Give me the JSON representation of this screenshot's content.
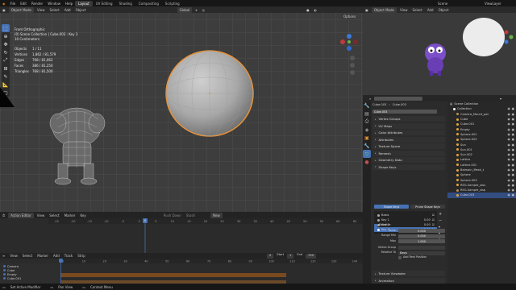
{
  "topbar": {
    "menus": [
      "File",
      "Edit",
      "Render",
      "Window",
      "Help"
    ],
    "workspaces": [
      "Layout",
      "UV Editing",
      "Shading",
      "Compositing",
      "Scripting"
    ],
    "active_workspace": "Layout",
    "scene_label": "Scene",
    "view_layer_label": "ViewLayer"
  },
  "viewport": {
    "mode": "Object Mode",
    "menus": [
      "View",
      "Select",
      "Add",
      "Object"
    ],
    "orientation": "Global",
    "options_label": "Options",
    "info": {
      "view_name": "Front Orthographic",
      "collection_line": "(0) Scene Collection | Cube.003 : Key 3",
      "units": "10 Centimeters"
    },
    "stats": [
      {
        "label": "Objects",
        "value": "1 / 11"
      },
      {
        "label": "Vertices",
        "value": "1,862 / 81,579"
      },
      {
        "label": "Edges",
        "value": "768 / 81,062"
      },
      {
        "label": "Faces",
        "value": "386 / 81,250"
      },
      {
        "label": "Triangles",
        "value": "768 / 81,500"
      }
    ]
  },
  "action_editor": {
    "mode": "Action Editor",
    "menus": [
      "View",
      "Select",
      "Marker",
      "Key"
    ],
    "push_down": "Push Down",
    "stash": "Stash",
    "new_label": "New",
    "ruler_ticks": [
      "-25",
      "-20",
      "-15",
      "-10",
      "-5",
      "0",
      "5",
      "10",
      "15",
      "20",
      "25",
      "30",
      "35",
      "40",
      "45",
      "50",
      "55",
      "60",
      "65"
    ],
    "current_frame": "0"
  },
  "nla": {
    "menus": [
      "View",
      "Select",
      "Marker",
      "Add",
      "Track",
      "Strip"
    ],
    "ruler_ticks": [
      "0",
      "10",
      "20",
      "30",
      "40",
      "50",
      "60",
      "70",
      "80",
      "90",
      "100",
      "110",
      "120",
      "130",
      "140"
    ],
    "tracks": [
      "Camera",
      "Cube",
      "Empty",
      "Cube.001",
      "REG-Sample_sload_spline",
      "<No Action>"
    ]
  },
  "playback": {
    "start_label": "Start",
    "start_value": "1",
    "end_label": "End",
    "end_value": "250",
    "frame": "0"
  },
  "status": {
    "left": "Set Active Modifier",
    "mid": "Pan View",
    "right": "Context Menu"
  },
  "preview": {
    "mode": "Object Mode",
    "menus": [
      "View",
      "Select",
      "Add",
      "Object"
    ],
    "orientation": "Global"
  },
  "properties": {
    "object_name": "Cube.003",
    "mesh_name": "Cube.003",
    "panels": [
      "Vertex Groups",
      "UV Maps",
      "Color Attributes",
      "Attributes",
      "Texture Space",
      "Remesh",
      "Geometry Data"
    ],
    "shape_keys_title": "Shape Keys",
    "shape_key_tabs": [
      "Shape Keys",
      "Prune Shape Keys"
    ],
    "shape_keys": [
      {
        "name": "Basis",
        "value": ""
      },
      {
        "name": "Key 1",
        "value": "0.00"
      },
      {
        "name": "Key 2",
        "value": "0.00"
      },
      {
        "name": "Key 3",
        "value": "0.00"
      }
    ],
    "relative_label": "Relative",
    "value_label": "Value",
    "value": "0.000",
    "range_min_label": "Range Min",
    "range_min": "0.000",
    "max_label": "Max",
    "max": "1.000",
    "vertex_group_label": "Vertex Group",
    "relative_to_label": "Relative To",
    "relative_to": "Basis",
    "add_rest_label": "Add Rest Position",
    "bottom_panels": [
      "Texture Viewbake",
      "Animation"
    ]
  },
  "outliner": {
    "title": "Scene Collection",
    "items": [
      {
        "name": "Collection",
        "indent": 1,
        "color": "#ffffff",
        "sel": false
      },
      {
        "name": "Camera_Mount_pat",
        "indent": 2,
        "color": "#b98f5a",
        "sel": false
      },
      {
        "name": "Cube",
        "indent": 2,
        "color": "#e8a53a",
        "sel": false
      },
      {
        "name": "Cube.001",
        "indent": 2,
        "color": "#e8a53a",
        "sel": false
      },
      {
        "name": "Empty",
        "indent": 2,
        "color": "#e8a53a",
        "sel": false
      },
      {
        "name": "Sphere.001",
        "indent": 2,
        "color": "#e8a53a",
        "sel": false
      },
      {
        "name": "Sphere.002",
        "indent": 2,
        "color": "#e8a53a",
        "sel": false
      },
      {
        "name": "Sun",
        "indent": 2,
        "color": "#e8a53a",
        "sel": false
      },
      {
        "name": "Sun.001",
        "indent": 2,
        "color": "#e8a53a",
        "sel": false
      },
      {
        "name": "Sun.002",
        "indent": 2,
        "color": "#e8a53a",
        "sel": false
      },
      {
        "name": "Lattice",
        "indent": 2,
        "color": "#e8a53a",
        "sel": false
      },
      {
        "name": "Lattice.001",
        "indent": 2,
        "color": "#e8a53a",
        "sel": false
      },
      {
        "name": "Balmain_Mesh_t",
        "indent": 2,
        "color": "#e8a53a",
        "sel": false
      },
      {
        "name": "Sphere",
        "indent": 2,
        "color": "#e8a53a",
        "sel": false
      },
      {
        "name": "Sphere.003",
        "indent": 2,
        "color": "#e8a53a",
        "sel": false
      },
      {
        "name": "REG-Sample_slos",
        "indent": 2,
        "color": "#e8a53a",
        "sel": false
      },
      {
        "name": "REG-Sample_slsp",
        "indent": 2,
        "color": "#b98f5a",
        "sel": false
      },
      {
        "name": "Cube.003",
        "indent": 2,
        "color": "#e8a53a",
        "sel": true
      }
    ]
  },
  "colors": {
    "accent": "#4772b3",
    "selection_outline": "#e8943a",
    "playhead": "#4772b3"
  }
}
